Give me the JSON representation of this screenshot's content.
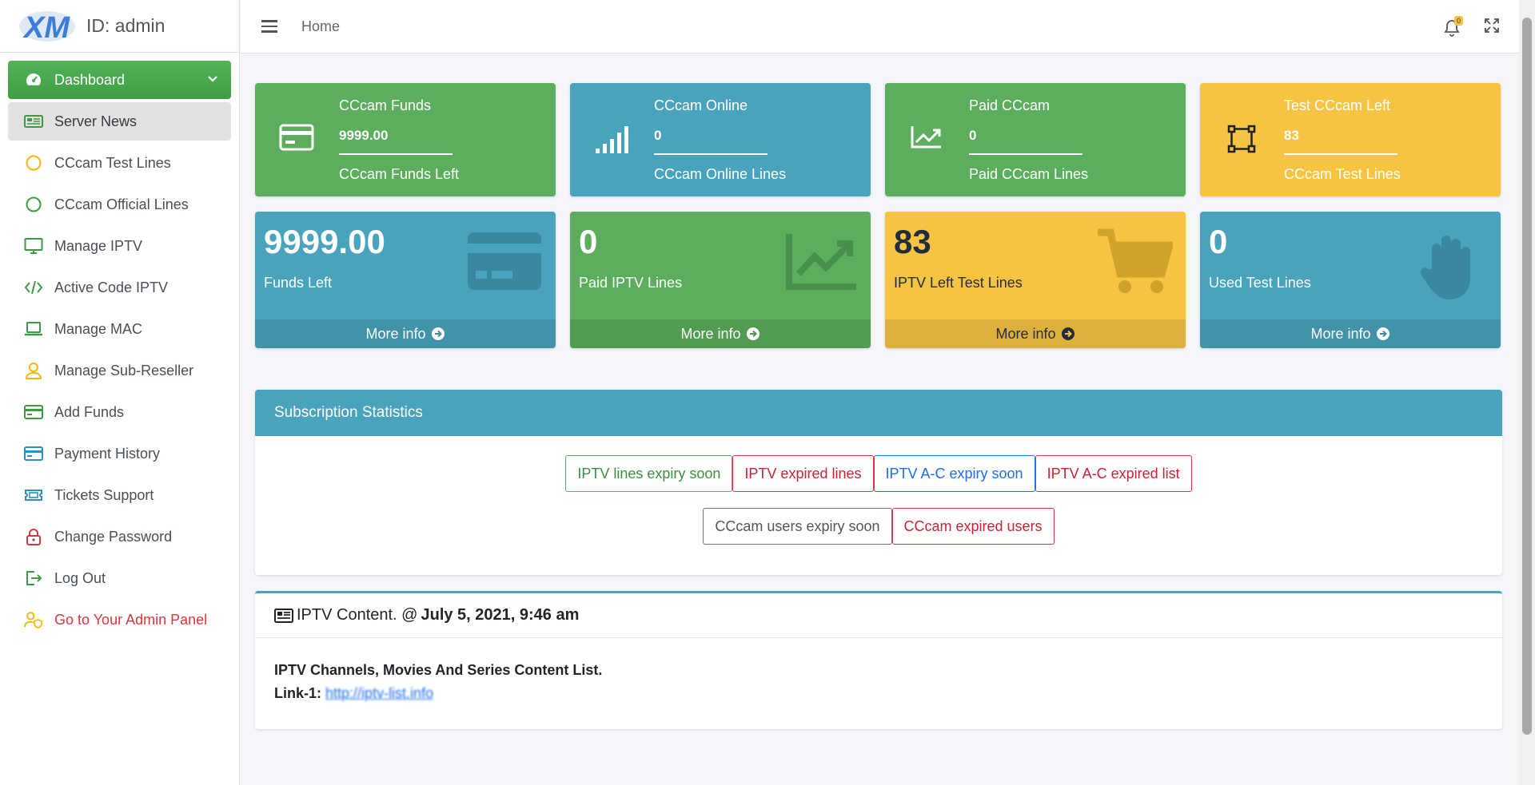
{
  "brand": {
    "id_label": "ID: admin"
  },
  "sidebar": {
    "items": [
      {
        "label": "Dashboard",
        "icon": "tachometer-icon"
      },
      {
        "label": "Server News",
        "icon": "newspaper-icon"
      },
      {
        "label": "CCcam Test Lines",
        "icon": "circle-icon"
      },
      {
        "label": "CCcam Official Lines",
        "icon": "circle-icon"
      },
      {
        "label": "Manage IPTV",
        "icon": "monitor-icon"
      },
      {
        "label": "Active Code IPTV",
        "icon": "code-icon"
      },
      {
        "label": "Manage MAC",
        "icon": "laptop-icon"
      },
      {
        "label": "Manage Sub-Reseller",
        "icon": "user-icon"
      },
      {
        "label": "Add Funds",
        "icon": "credit-card-icon"
      },
      {
        "label": "Payment History",
        "icon": "credit-card-icon"
      },
      {
        "label": "Tickets Support",
        "icon": "ticket-icon"
      },
      {
        "label": "Change Password",
        "icon": "lock-icon"
      },
      {
        "label": "Log Out",
        "icon": "logout-icon"
      },
      {
        "label": "Go to Your Admin Panel",
        "icon": "user-shield-icon"
      }
    ]
  },
  "header": {
    "home": "Home",
    "notif_count": "0"
  },
  "stats_top": [
    {
      "title": "CCcam Funds",
      "value": "9999.00",
      "subtitle": "CCcam Funds Left",
      "icon": "credit-card-icon",
      "color": "#5cad5d"
    },
    {
      "title": "CCcam Online",
      "value": "0",
      "subtitle": "CCcam Online Lines",
      "icon": "signal-icon",
      "color": "#4aa3bd"
    },
    {
      "title": "Paid CCcam",
      "value": "0",
      "subtitle": "Paid CCcam Lines",
      "icon": "chart-line-icon",
      "color": "#5cad5d"
    },
    {
      "title": "Test CCcam Left",
      "value": "83",
      "subtitle": "CCcam Test Lines",
      "icon": "vector-square-icon",
      "color": "#f6c342"
    }
  ],
  "stats_bottom": [
    {
      "value": "9999.00",
      "label": "Funds Left",
      "more": "More info",
      "icon": "credit-card-icon"
    },
    {
      "value": "0",
      "label": "Paid IPTV Lines",
      "more": "More info",
      "icon": "chart-area-icon"
    },
    {
      "value": "83",
      "label": "IPTV Left Test Lines",
      "more": "More info",
      "icon": "shopping-cart-icon"
    },
    {
      "value": "0",
      "label": "Used Test Lines",
      "more": "More info",
      "icon": "hand-icon"
    }
  ],
  "subscription": {
    "title": "Subscription Statistics",
    "buttons_row1": [
      "IPTV lines expiry soon",
      "IPTV expired lines",
      "IPTV A-C expiry soon",
      "IPTV A-C expired list"
    ],
    "buttons_row2": [
      "CCcam users expiry soon",
      "CCcam expired users"
    ]
  },
  "news": {
    "title": "IPTV Content. @",
    "date": "July 5, 2021, 9:46 am",
    "line1": "IPTV Channels, Movies And Series Content List.",
    "link_label": "Link-1:",
    "link_text": "http://iptv-list.info"
  }
}
